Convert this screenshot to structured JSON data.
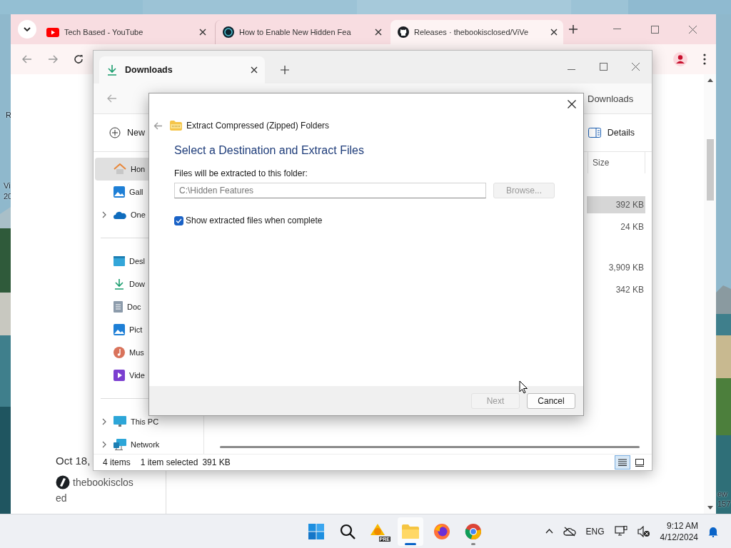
{
  "desktop": {
    "labels": [
      "R",
      "Vi",
      "20",
      "ew",
      "157"
    ]
  },
  "browser": {
    "tabs": [
      {
        "kind": "youtube",
        "title": "Tech Based - YouTube",
        "selected": false
      },
      {
        "kind": "tb",
        "title": "How to Enable New Hidden Fea",
        "selected": false
      },
      {
        "kind": "github",
        "title": "Releases · thebookisclosed/ViVe",
        "selected": true
      }
    ],
    "page": {
      "date": "Oct 18,",
      "author_lines": [
        "thebookisclos",
        "ed"
      ]
    }
  },
  "explorer": {
    "tab": "Downloads",
    "search": "Downloads",
    "new_label": "New",
    "details_label": "Details",
    "nav_groups": [
      [
        {
          "label": "Hon",
          "kind": "home",
          "selected": true,
          "expandable": false
        },
        {
          "label": "Gall",
          "kind": "gallery",
          "selected": false,
          "expandable": false
        },
        {
          "label": "One",
          "kind": "cloud",
          "selected": false,
          "expandable": true
        }
      ],
      [
        {
          "label": "Desl",
          "kind": "desktop",
          "selected": false,
          "expandable": false
        },
        {
          "label": "Dow",
          "kind": "download",
          "selected": false,
          "expandable": false
        },
        {
          "label": "Doc",
          "kind": "document",
          "selected": false,
          "expandable": false
        },
        {
          "label": "Pict",
          "kind": "pictures",
          "selected": false,
          "expandable": false
        },
        {
          "label": "Mus",
          "kind": "music",
          "selected": false,
          "expandable": false
        },
        {
          "label": "Vide",
          "kind": "videos",
          "selected": false,
          "expandable": false
        }
      ],
      [
        {
          "label": "This PC",
          "kind": "pc",
          "selected": false,
          "expandable": true
        },
        {
          "label": "Network",
          "kind": "network",
          "selected": false,
          "expandable": true
        }
      ]
    ],
    "size_header": "Size",
    "row_groups": [
      [
        {
          "size": "392 KB",
          "selected": true
        },
        {
          "size": "24 KB",
          "selected": false
        }
      ],
      [
        {
          "size": "3,909 KB",
          "selected": false
        },
        {
          "size": "342 KB",
          "selected": false
        }
      ]
    ],
    "status": {
      "items": "4 items",
      "selection": "1 item selected",
      "selection_size": "391 KB"
    },
    "views": [
      {
        "kind": "details",
        "selected": true
      },
      {
        "kind": "tiles",
        "selected": false
      }
    ]
  },
  "dialog": {
    "wizard_title": "Extract Compressed (Zipped) Folders",
    "heading": "Select a Destination and Extract Files",
    "folder_label": "Files will be extracted to this folder:",
    "folder_value": "C:\\Hidden Features",
    "browse": {
      "label": "Browse...",
      "disabled": true
    },
    "show_files": {
      "label": "Show extracted files when complete",
      "checked": true
    },
    "buttons": [
      {
        "label": "Next",
        "disabled": true
      },
      {
        "label": "Cancel",
        "disabled": false
      }
    ]
  },
  "taskbar": {
    "apps": [
      {
        "kind": "start",
        "open": false,
        "focused": false
      },
      {
        "kind": "search",
        "open": false,
        "focused": false
      },
      {
        "kind": "pre",
        "badge": "PRE",
        "open": false,
        "focused": false
      },
      {
        "kind": "explorer",
        "open": true,
        "focused": true
      },
      {
        "kind": "firefox",
        "open": false,
        "focused": false
      },
      {
        "kind": "chrome",
        "open": true,
        "focused": false
      }
    ],
    "language": "ENG",
    "time": "9:12 AM",
    "date": "4/12/2024"
  }
}
